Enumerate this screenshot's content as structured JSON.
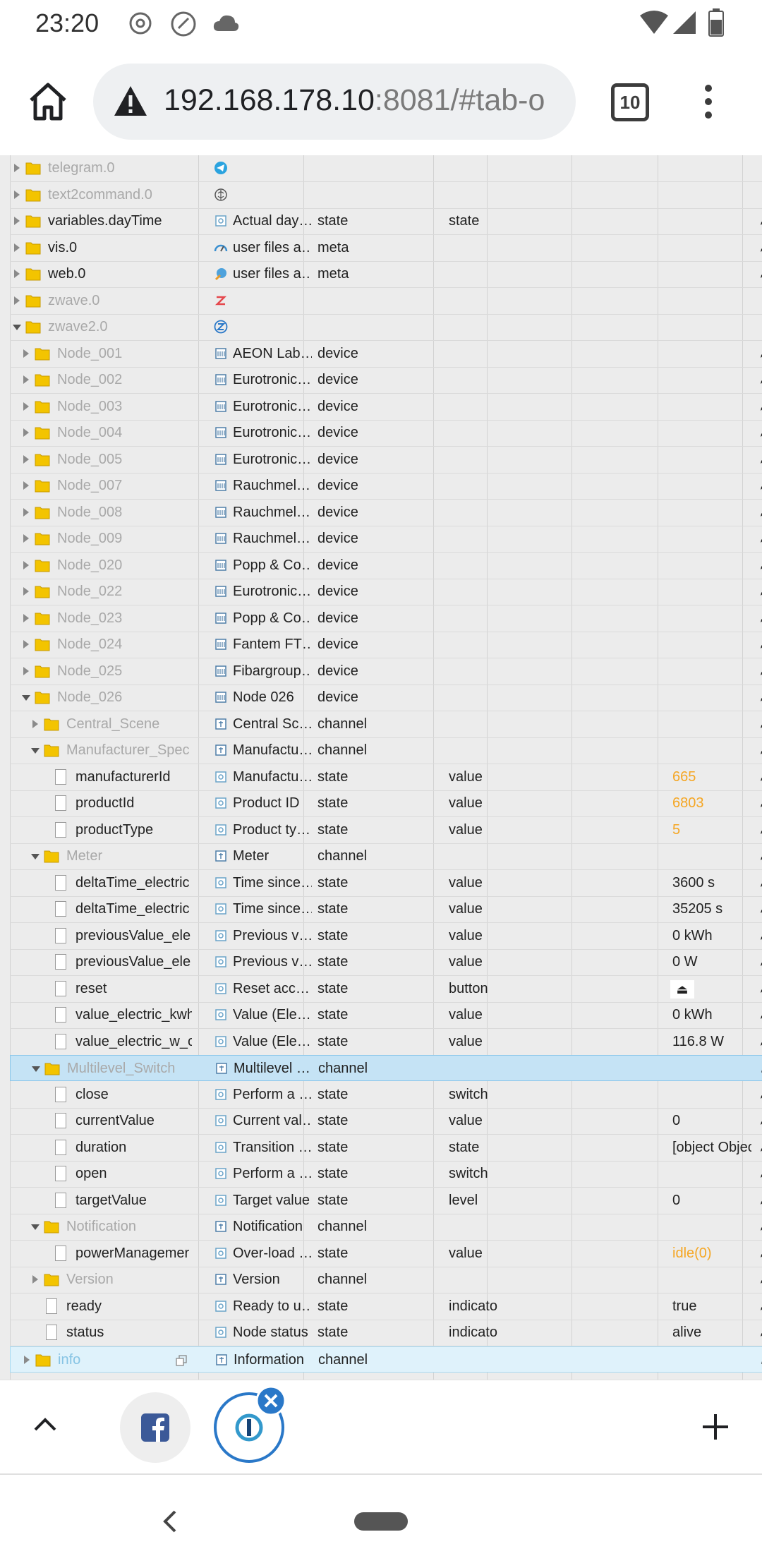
{
  "status_bar": {
    "time": "23:20"
  },
  "browser": {
    "url_host": "192.168.178.10",
    "url_rest": ":8081/#tab-o",
    "tab_count": "10"
  },
  "tree": [
    {
      "id": "telegram.0",
      "d": 0,
      "exp": "r",
      "icon": "folder",
      "dim": true,
      "ricon": "telegram-icon"
    },
    {
      "id": "text2command.0",
      "d": 0,
      "exp": "r",
      "icon": "folder",
      "dim": true,
      "ricon": "brain-icon"
    },
    {
      "id": "variables.dayTime",
      "d": 0,
      "exp": "r",
      "icon": "folder",
      "dim": false,
      "ricon": "state",
      "name": "Actual day…",
      "type": "state",
      "role": "state",
      "pen": true
    },
    {
      "id": "vis.0",
      "d": 0,
      "exp": "r",
      "icon": "folder",
      "dim": false,
      "ricon": "gauge-icon",
      "name": "user files a…",
      "type": "meta",
      "pen": true
    },
    {
      "id": "web.0",
      "d": 0,
      "exp": "r",
      "icon": "folder",
      "dim": false,
      "ricon": "globe-icon",
      "name": "user files a…",
      "type": "meta",
      "pen": true
    },
    {
      "id": "zwave.0",
      "d": 0,
      "exp": "r",
      "icon": "folder",
      "dim": true,
      "ricon": "zwave-icon"
    },
    {
      "id": "zwave2.0",
      "d": 0,
      "exp": "d",
      "icon": "folder",
      "dim": true,
      "ricon": "zwave2-icon"
    },
    {
      "id": "Node_001",
      "d": 1,
      "exp": "r",
      "icon": "folder",
      "dim": true,
      "ricon": "device",
      "name": "AEON Lab…",
      "type": "device",
      "pen": true
    },
    {
      "id": "Node_002",
      "d": 1,
      "exp": "r",
      "icon": "folder",
      "dim": true,
      "ricon": "device",
      "name": "Eurotronic…",
      "type": "device",
      "pen": true
    },
    {
      "id": "Node_003",
      "d": 1,
      "exp": "r",
      "icon": "folder",
      "dim": true,
      "ricon": "device",
      "name": "Eurotronic…",
      "type": "device",
      "pen": true
    },
    {
      "id": "Node_004",
      "d": 1,
      "exp": "r",
      "icon": "folder",
      "dim": true,
      "ricon": "device",
      "name": "Eurotronic…",
      "type": "device",
      "pen": true
    },
    {
      "id": "Node_005",
      "d": 1,
      "exp": "r",
      "icon": "folder",
      "dim": true,
      "ricon": "device",
      "name": "Eurotronic…",
      "type": "device",
      "pen": true
    },
    {
      "id": "Node_007",
      "d": 1,
      "exp": "r",
      "icon": "folder",
      "dim": true,
      "ricon": "device",
      "name": "Rauchmel…",
      "type": "device",
      "pen": true
    },
    {
      "id": "Node_008",
      "d": 1,
      "exp": "r",
      "icon": "folder",
      "dim": true,
      "ricon": "device",
      "name": "Rauchmel…",
      "type": "device",
      "pen": true
    },
    {
      "id": "Node_009",
      "d": 1,
      "exp": "r",
      "icon": "folder",
      "dim": true,
      "ricon": "device",
      "name": "Rauchmel…",
      "type": "device",
      "pen": true
    },
    {
      "id": "Node_020",
      "d": 1,
      "exp": "r",
      "icon": "folder",
      "dim": true,
      "ricon": "device",
      "name": "Popp & Co…",
      "type": "device",
      "pen": true
    },
    {
      "id": "Node_022",
      "d": 1,
      "exp": "r",
      "icon": "folder",
      "dim": true,
      "ricon": "device",
      "name": "Eurotronic…",
      "type": "device",
      "pen": true
    },
    {
      "id": "Node_023",
      "d": 1,
      "exp": "r",
      "icon": "folder",
      "dim": true,
      "ricon": "device",
      "name": "Popp & Co…",
      "type": "device",
      "pen": true
    },
    {
      "id": "Node_024",
      "d": 1,
      "exp": "r",
      "icon": "folder",
      "dim": true,
      "ricon": "device",
      "name": "Fantem FT…",
      "type": "device",
      "pen": true
    },
    {
      "id": "Node_025",
      "d": 1,
      "exp": "r",
      "icon": "folder",
      "dim": true,
      "ricon": "device",
      "name": "Fibargroup…",
      "type": "device",
      "pen": true
    },
    {
      "id": "Node_026",
      "d": 1,
      "exp": "d",
      "icon": "folder",
      "dim": true,
      "ricon": "device",
      "name": "Node 026",
      "type": "device",
      "pen": true
    },
    {
      "id": "Central_Scene",
      "d": 2,
      "exp": "r",
      "icon": "folder",
      "dim": true,
      "ricon": "channel",
      "name": "Central Sc…",
      "type": "channel",
      "pen": true
    },
    {
      "id": "Manufacturer_Spec",
      "d": 2,
      "exp": "d",
      "icon": "folder",
      "dim": true,
      "ricon": "channel",
      "name": "Manufactu…",
      "type": "channel",
      "pen": true
    },
    {
      "id": "manufacturerId",
      "d": 3,
      "icon": "file",
      "ricon": "state",
      "name": "Manufactu…",
      "type": "state",
      "role": "value",
      "val": "665",
      "orange": true,
      "pen": true
    },
    {
      "id": "productId",
      "d": 3,
      "icon": "file",
      "ricon": "state",
      "name": "Product ID",
      "type": "state",
      "role": "value",
      "val": "6803",
      "orange": true,
      "pen": true
    },
    {
      "id": "productType",
      "d": 3,
      "icon": "file",
      "ricon": "state",
      "name": "Product ty…",
      "type": "state",
      "role": "value",
      "val": "5",
      "orange": true,
      "pen": true
    },
    {
      "id": "Meter",
      "d": 2,
      "exp": "d",
      "icon": "folder",
      "dim": true,
      "ricon": "channel",
      "name": "Meter",
      "type": "channel",
      "pen": true
    },
    {
      "id": "deltaTime_electric",
      "d": 3,
      "icon": "file",
      "ricon": "state",
      "name": "Time since…",
      "type": "state",
      "role": "value",
      "val": "3600 s",
      "pen": true
    },
    {
      "id": "deltaTime_electric",
      "d": 3,
      "icon": "file",
      "ricon": "state",
      "name": "Time since…",
      "type": "state",
      "role": "value",
      "val": "35205 s",
      "pen": true
    },
    {
      "id": "previousValue_ele",
      "d": 3,
      "icon": "file",
      "ricon": "state",
      "name": "Previous v…",
      "type": "state",
      "role": "value",
      "val": "0 kWh",
      "pen": true
    },
    {
      "id": "previousValue_ele",
      "d": 3,
      "icon": "file",
      "ricon": "state",
      "name": "Previous v…",
      "type": "state",
      "role": "value",
      "val": "0 W",
      "pen": true
    },
    {
      "id": "reset",
      "d": 3,
      "icon": "file",
      "ricon": "state",
      "name": "Reset acc…",
      "type": "state",
      "role": "button",
      "val": "⏏",
      "btnval": true,
      "pen": true
    },
    {
      "id": "value_electric_kwh",
      "d": 3,
      "icon": "file",
      "ricon": "state",
      "name": "Value (Ele…",
      "type": "state",
      "role": "value",
      "val": "0 kWh",
      "pen": true
    },
    {
      "id": "value_electric_w_c",
      "d": 3,
      "icon": "file",
      "ricon": "state",
      "name": "Value (Ele…",
      "type": "state",
      "role": "value",
      "val": "116.8 W",
      "pen": true
    },
    {
      "id": "Multilevel_Switch",
      "d": 2,
      "exp": "d",
      "icon": "folder",
      "dim": true,
      "ricon": "channel",
      "name": "Multilevel …",
      "type": "channel",
      "pen": true,
      "sel": true
    },
    {
      "id": "close",
      "d": 3,
      "icon": "file",
      "ricon": "state",
      "name": "Perform a …",
      "type": "state",
      "role": "switch",
      "pen": true
    },
    {
      "id": "currentValue",
      "d": 3,
      "icon": "file",
      "ricon": "state",
      "name": "Current val…",
      "type": "state",
      "role": "value",
      "val": "0",
      "pen": true
    },
    {
      "id": "duration",
      "d": 3,
      "icon": "file",
      "ricon": "state",
      "name": "Transition …",
      "type": "state",
      "role": "state",
      "val": "[object Objec",
      "pen": true
    },
    {
      "id": "open",
      "d": 3,
      "icon": "file",
      "ricon": "state",
      "name": "Perform a …",
      "type": "state",
      "role": "switch",
      "pen": true
    },
    {
      "id": "targetValue",
      "d": 3,
      "icon": "file",
      "ricon": "state",
      "name": "Target value",
      "type": "state",
      "role": "level",
      "val": "0",
      "pen": true
    },
    {
      "id": "Notification",
      "d": 2,
      "exp": "d",
      "icon": "folder",
      "dim": true,
      "ricon": "channel",
      "name": "Notification",
      "type": "channel",
      "pen": true
    },
    {
      "id": "powerManagemer",
      "d": 3,
      "icon": "file",
      "ricon": "state",
      "name": "Over-load …",
      "type": "state",
      "role": "value",
      "val": "idle(0)",
      "orange": true,
      "pen": true
    },
    {
      "id": "Version",
      "d": 2,
      "exp": "r",
      "icon": "folder",
      "dim": true,
      "ricon": "channel",
      "name": "Version",
      "type": "channel",
      "pen": true
    },
    {
      "id": "ready",
      "d": 2,
      "icon": "file",
      "ricon": "state",
      "name": "Ready to u…",
      "type": "state",
      "role": "indicato",
      "val": "true",
      "pen": true
    },
    {
      "id": "status",
      "d": 2,
      "icon": "file",
      "ricon": "state",
      "name": "Node status",
      "type": "state",
      "role": "indicato",
      "val": "alive",
      "pen": true
    },
    {
      "id": "info",
      "d": 1,
      "exp": "r",
      "icon": "folder",
      "blue": true,
      "ricon": "channel",
      "name": "Information",
      "type": "channel",
      "pen": true,
      "hl": true,
      "copy": true
    }
  ],
  "colors": {
    "accent_blue": "#2a78c8",
    "orange_value": "#f5a623",
    "selection": "#c5e3f5"
  },
  "icons": {
    "home": "home-icon",
    "warning": "warning-icon",
    "tabs": "tab-switcher-icon",
    "menu": "more-vert-icon",
    "up": "chevron-up-icon",
    "facebook": "facebook-icon",
    "iobroker": "iobroker-icon",
    "close": "close-badge-icon",
    "plus": "plus-icon",
    "back": "back-icon"
  }
}
